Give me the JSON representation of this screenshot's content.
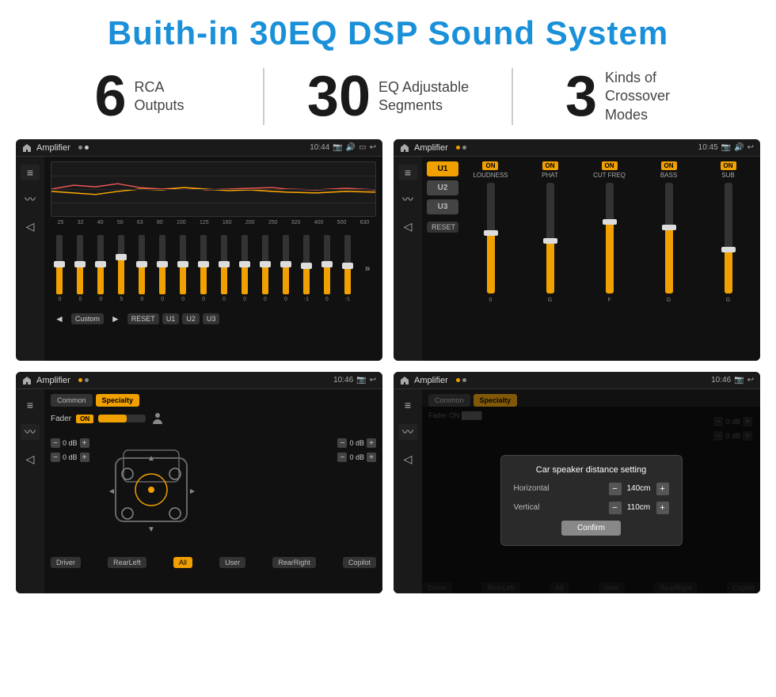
{
  "page": {
    "title": "Buith-in 30EQ DSP Sound System",
    "stats": [
      {
        "number": "6",
        "label": "RCA\nOutputs"
      },
      {
        "number": "30",
        "label": "EQ Adjustable\nSegments"
      },
      {
        "number": "3",
        "label": "Kinds of\nCrossover Modes"
      }
    ],
    "screens": {
      "eq": {
        "status_left": "Amplifier",
        "status_time": "10:44",
        "freqs": [
          "25",
          "32",
          "40",
          "50",
          "63",
          "80",
          "100",
          "125",
          "160",
          "200",
          "250",
          "320",
          "400",
          "500",
          "630"
        ],
        "values": [
          "0",
          "0",
          "0",
          "5",
          "0",
          "0",
          "0",
          "0",
          "0",
          "0",
          "0",
          "0",
          "-1",
          "0",
          "-1"
        ],
        "buttons": [
          "Custom",
          "RESET",
          "U1",
          "U2",
          "U3"
        ]
      },
      "crossover": {
        "status_left": "Amplifier",
        "status_time": "10:45",
        "presets": [
          "U1",
          "U2",
          "U3"
        ],
        "channels": [
          {
            "label": "LOUDNESS",
            "on": true
          },
          {
            "label": "PHAT",
            "on": true
          },
          {
            "label": "CUT FREQ",
            "on": true
          },
          {
            "label": "BASS",
            "on": true
          },
          {
            "label": "SUB",
            "on": true
          }
        ],
        "reset_label": "RESET"
      },
      "fader": {
        "status_left": "Amplifier",
        "status_time": "10:46",
        "tabs": [
          "Common",
          "Specialty"
        ],
        "fader_label": "Fader",
        "on_label": "ON",
        "buttons": [
          "Driver",
          "RearLeft",
          "All",
          "User",
          "RearRight",
          "Copilot"
        ],
        "db_values": [
          "0 dB",
          "0 dB",
          "0 dB",
          "0 dB"
        ]
      },
      "distance": {
        "status_left": "Amplifier",
        "status_time": "10:46",
        "tabs": [
          "Common",
          "Specialty"
        ],
        "dialog": {
          "title": "Car speaker distance setting",
          "horizontal_label": "Horizontal",
          "horizontal_value": "140cm",
          "vertical_label": "Vertical",
          "vertical_value": "110cm",
          "confirm_label": "Confirm"
        },
        "buttons": [
          "Driver",
          "RearLeft",
          "All",
          "User",
          "RearRight",
          "Copilot"
        ],
        "db_values": [
          "0 dB",
          "0 dB"
        ]
      }
    }
  }
}
